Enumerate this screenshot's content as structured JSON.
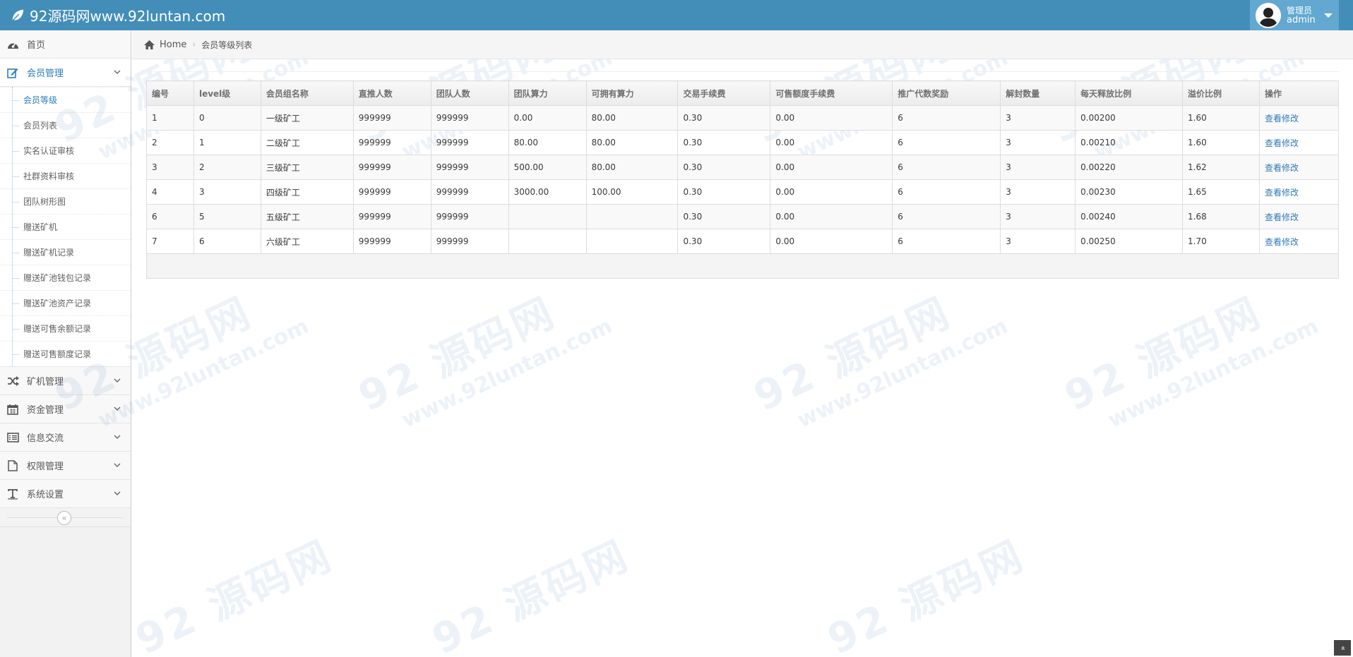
{
  "navbar": {
    "brand": "92源码网www.92luntan.com",
    "user_role": "管理员",
    "user_name": "admin"
  },
  "sidebar": {
    "items": [
      {
        "label": "首页",
        "icon": "dashboard-icon"
      },
      {
        "label": "会员管理",
        "icon": "edit-icon",
        "expanded": true,
        "children": [
          "会员等级",
          "会员列表",
          "实名认证审核",
          "社群资料审核",
          "团队树形图",
          "赠送矿机",
          "赠送矿机记录",
          "赠送矿池钱包记录",
          "赠送矿池资产记录",
          "赠送可售余额记录",
          "赠送可售额度记录"
        ]
      },
      {
        "label": "矿机管理",
        "icon": "random-icon"
      },
      {
        "label": "资金管理",
        "icon": "calendar-icon"
      },
      {
        "label": "信息交流",
        "icon": "list-icon"
      },
      {
        "label": "权限管理",
        "icon": "file-icon"
      },
      {
        "label": "系统设置",
        "icon": "text-icon"
      }
    ],
    "collapse_glyph": "«"
  },
  "breadcrumb": {
    "home": "Home",
    "current": "会员等级列表"
  },
  "table": {
    "headers": [
      "编号",
      "level级",
      "会员组名称",
      "直推人数",
      "团队人数",
      "团队算力",
      "可拥有算力",
      "交易手续费",
      "可售额度手续费",
      "推广代数奖励",
      "解封数量",
      "每天释放比例",
      "溢价比例",
      "操作"
    ],
    "rows": [
      [
        "1",
        "0",
        "一级矿工",
        "999999",
        "999999",
        "0.00",
        "80.00",
        "0.30",
        "0.00",
        "6",
        "3",
        "0.00200",
        "1.60",
        "查看修改"
      ],
      [
        "2",
        "1",
        "二级矿工",
        "999999",
        "999999",
        "80.00",
        "80.00",
        "0.30",
        "0.00",
        "6",
        "3",
        "0.00210",
        "1.60",
        "查看修改"
      ],
      [
        "3",
        "2",
        "三级矿工",
        "999999",
        "999999",
        "500.00",
        "80.00",
        "0.30",
        "0.00",
        "6",
        "3",
        "0.00220",
        "1.62",
        "查看修改"
      ],
      [
        "4",
        "3",
        "四级矿工",
        "999999",
        "999999",
        "3000.00",
        "100.00",
        "0.30",
        "0.00",
        "6",
        "3",
        "0.00230",
        "1.65",
        "查看修改"
      ],
      [
        "6",
        "5",
        "五级矿工",
        "999999",
        "999999",
        "",
        "",
        "0.30",
        "0.00",
        "6",
        "3",
        "0.00240",
        "1.68",
        "查看修改"
      ],
      [
        "7",
        "6",
        "六级矿工",
        "999999",
        "999999",
        "",
        "",
        "0.30",
        "0.00",
        "6",
        "3",
        "0.00250",
        "1.70",
        "查看修改"
      ]
    ]
  },
  "watermark": {
    "big": "92 源码网",
    "small": "www.92luntan.com"
  },
  "scroll_top_glyph": "»",
  "colors": {
    "navbar": "#438eb9",
    "user_box": "#62a8d1",
    "link": "#337ab7",
    "active_menu": "#2b7dbc"
  }
}
